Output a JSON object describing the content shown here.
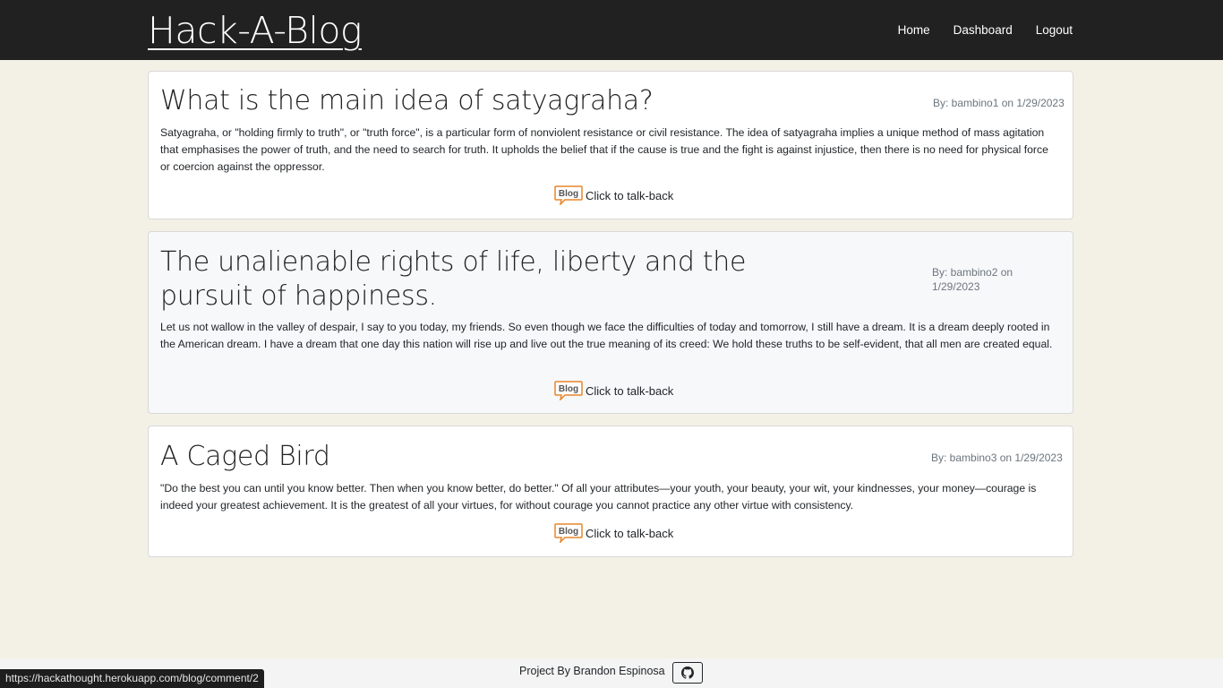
{
  "header": {
    "brand": "Hack-A-Blog",
    "nav": [
      {
        "label": "Home"
      },
      {
        "label": "Dashboard"
      },
      {
        "label": "Logout"
      }
    ]
  },
  "posts": [
    {
      "title": "What is the main idea of satyagraha?",
      "byline": "By: bambino1 on 1/29/2023",
      "body": "Satyagraha, or \"holding firmly to truth\", or \"truth force\", is a particular form of nonviolent resistance or civil resistance. The idea of satyagraha implies a unique method of mass agitation that emphasises the power of truth, and the need to search for truth. It upholds the belief that if the cause is true and the fight is against injustice, then there is no need for physical force or coercion against the oppressor.",
      "talkback": "Click to talk-back"
    },
    {
      "title": "The unalienable rights of life, liberty and the pursuit of happiness.",
      "byline": "By: bambino2 on 1/29/2023",
      "body": "Let us not wallow in the valley of despair, I say to you today, my friends. So even though we face the difficulties of today and tomorrow, I still have a dream. It is a dream deeply rooted in the American dream. I have a dream that one day this nation will rise up and live out the true meaning of its creed: We hold these truths to be self-evident, that all men are created equal.",
      "talkback": "Click to talk-back"
    },
    {
      "title": "A Caged Bird",
      "byline": "By: bambino3 on 1/29/2023",
      "body": "\"Do the best you can until you know better. Then when you know better, do better.\" Of all your attributes—your youth, your beauty, your wit, your kindnesses, your money—courage is indeed your greatest achievement. It is the greatest of all your virtues, for without courage you cannot practice any other virtue with consistency.",
      "talkback": "Click to talk-back"
    }
  ],
  "blog_icon_text": "Blog",
  "footer": {
    "text": "Project By Brandon Espinosa",
    "github_icon": "github-icon"
  },
  "status_bar": {
    "url": "https://hackathought.herokuapp.com/blog/comment/2"
  },
  "colors": {
    "header_bg": "#212121",
    "page_bg": "#f3f1e6",
    "blog_icon_orange": "#e8862a"
  }
}
